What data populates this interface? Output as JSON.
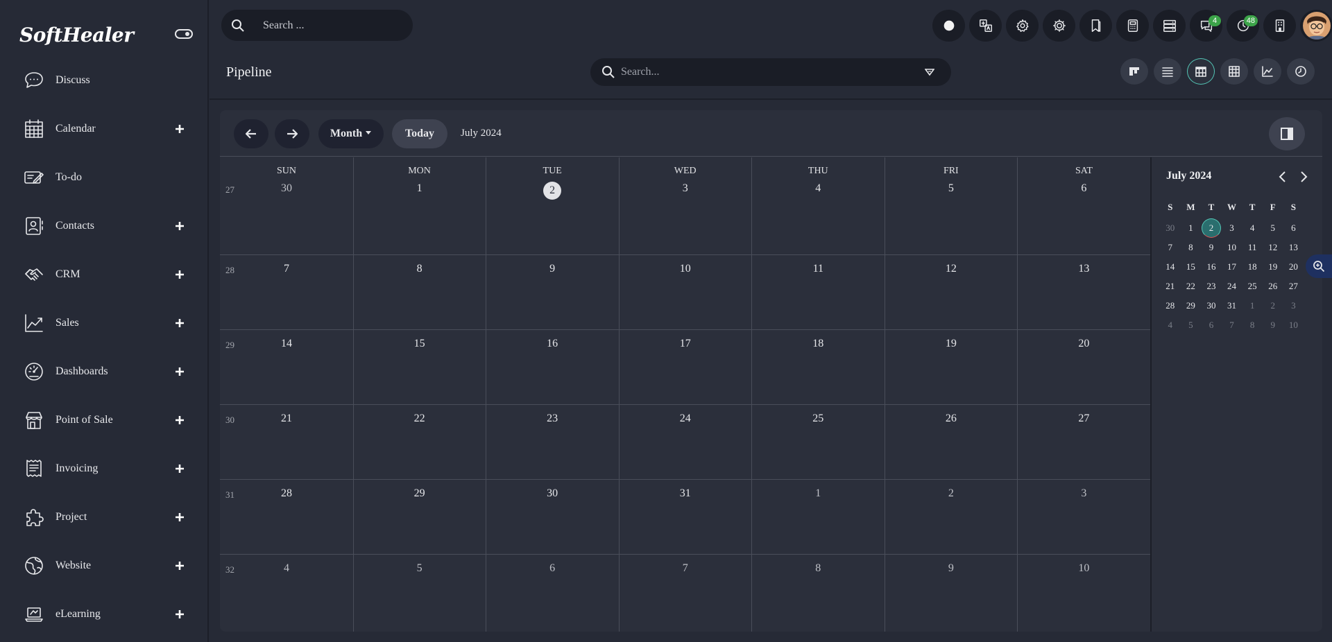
{
  "brand": {
    "logo_text": "SoftHealer"
  },
  "sidebar": {
    "items": [
      {
        "label": "Discuss",
        "icon": "chat-bubble-icon",
        "has_plus": false
      },
      {
        "label": "Calendar",
        "icon": "calendar-icon",
        "has_plus": true
      },
      {
        "label": "To-do",
        "icon": "note-edit-icon",
        "has_plus": false
      },
      {
        "label": "Contacts",
        "icon": "contact-card-icon",
        "has_plus": true
      },
      {
        "label": "CRM",
        "icon": "handshake-icon",
        "has_plus": true
      },
      {
        "label": "Sales",
        "icon": "trend-chart-icon",
        "has_plus": true
      },
      {
        "label": "Dashboards",
        "icon": "gauge-icon",
        "has_plus": true
      },
      {
        "label": "Point of Sale",
        "icon": "store-icon",
        "has_plus": true
      },
      {
        "label": "Invoicing",
        "icon": "receipt-icon",
        "has_plus": true
      },
      {
        "label": "Project",
        "icon": "puzzle-icon",
        "has_plus": true
      },
      {
        "label": "Website",
        "icon": "globe-icon",
        "has_plus": true
      },
      {
        "label": "eLearning",
        "icon": "laptop-icon",
        "has_plus": true
      }
    ]
  },
  "topbar": {
    "search_placeholder": "Search ...",
    "icons": [
      {
        "name": "status-dot-icon",
        "badge": ""
      },
      {
        "name": "translate-icon",
        "badge": ""
      },
      {
        "name": "settings-gear-icon",
        "badge": ""
      },
      {
        "name": "debug-gear-icon",
        "badge": ""
      },
      {
        "name": "bookmark-icon",
        "badge": ""
      },
      {
        "name": "calculator-icon",
        "badge": ""
      },
      {
        "name": "server-icon",
        "badge": ""
      },
      {
        "name": "messages-icon",
        "badge": "4"
      },
      {
        "name": "activity-clock-icon",
        "badge": "48"
      },
      {
        "name": "company-building-icon",
        "badge": ""
      }
    ]
  },
  "header": {
    "title": "Pipeline",
    "search_placeholder": "Search...",
    "views": [
      "kanban-view-icon",
      "list-view-icon",
      "calendar-view-icon",
      "pivot-view-icon",
      "graph-view-icon",
      "activity-view-icon"
    ],
    "active_view": 2
  },
  "calendar": {
    "month_label": "Month",
    "today_label": "Today",
    "range_label": "July 2024",
    "weekday_headers": [
      "SUN",
      "MON",
      "TUE",
      "WED",
      "THU",
      "FRI",
      "SAT"
    ],
    "week_numbers": [
      "27",
      "28",
      "29",
      "30",
      "31",
      "32"
    ],
    "weeks": [
      [
        "30",
        "1",
        "2",
        "3",
        "4",
        "5",
        "6"
      ],
      [
        "7",
        "8",
        "9",
        "10",
        "11",
        "12",
        "13"
      ],
      [
        "14",
        "15",
        "16",
        "17",
        "18",
        "19",
        "20"
      ],
      [
        "21",
        "22",
        "23",
        "24",
        "25",
        "26",
        "27"
      ],
      [
        "28",
        "29",
        "30",
        "31",
        "1",
        "2",
        "3"
      ],
      [
        "4",
        "5",
        "6",
        "7",
        "8",
        "9",
        "10"
      ]
    ],
    "today": "2"
  },
  "mini_calendar": {
    "title": "July 2024",
    "weekday_headers": [
      "S",
      "M",
      "T",
      "W",
      "T",
      "F",
      "S"
    ],
    "weeks": [
      [
        "30",
        "1",
        "2",
        "3",
        "4",
        "5",
        "6"
      ],
      [
        "7",
        "8",
        "9",
        "10",
        "11",
        "12",
        "13"
      ],
      [
        "14",
        "15",
        "16",
        "17",
        "18",
        "19",
        "20"
      ],
      [
        "21",
        "22",
        "23",
        "24",
        "25",
        "26",
        "27"
      ],
      [
        "28",
        "29",
        "30",
        "31",
        "1",
        "2",
        "3"
      ],
      [
        "4",
        "5",
        "6",
        "7",
        "8",
        "9",
        "10"
      ]
    ]
  },
  "colors": {
    "background": "#262a36",
    "panel": "#2b2f3b",
    "accent": "#54c6b6",
    "badge": "#3ca349"
  }
}
